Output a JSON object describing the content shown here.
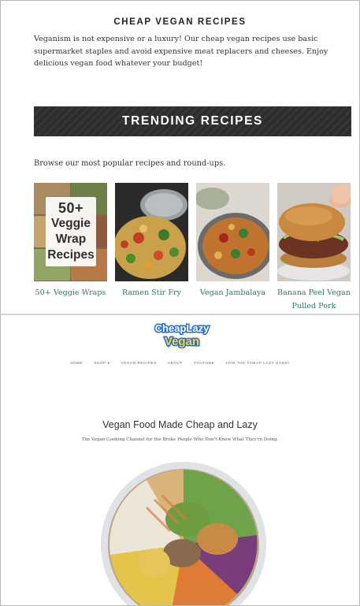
{
  "top": {
    "section_title": "CHEAP VEGAN RECIPES",
    "intro": "Veganism is not expensive or a luxury! Our cheap vegan recipes use basic supermarket staples and avoid expensive meat replacers and cheeses. Enjoy delicious vegan food whatever your budget!",
    "banner": "TRENDING RECIPES",
    "browse_text": "Browse our most popular recipes and round-ups.",
    "cards": [
      {
        "caption": "50+ Veggie Wraps",
        "overlay_lines": [
          "50+",
          "Veggie",
          "Wrap",
          "Recipes"
        ]
      },
      {
        "caption": "Ramen Stir Fry"
      },
      {
        "caption": "Vegan Jambalaya"
      },
      {
        "caption": "Banana Peel Vegan Pulled Pork"
      }
    ],
    "link_color": "#2a7a5f"
  },
  "bottom": {
    "logo_lines": [
      "CheapLazy",
      "Vegan"
    ],
    "nav": [
      "HOME",
      "SHOP ▾",
      "VEGAN RECIPES",
      "ABOUT",
      "YOUTUBE",
      "JOIN THE CHEAP LAZY GANG!"
    ],
    "hero_title": "Vegan Food Made Cheap and Lazy",
    "hero_subtitle": "The Vegan Cooking Channel for the Broke People Who Don't Know What They're Doing."
  }
}
